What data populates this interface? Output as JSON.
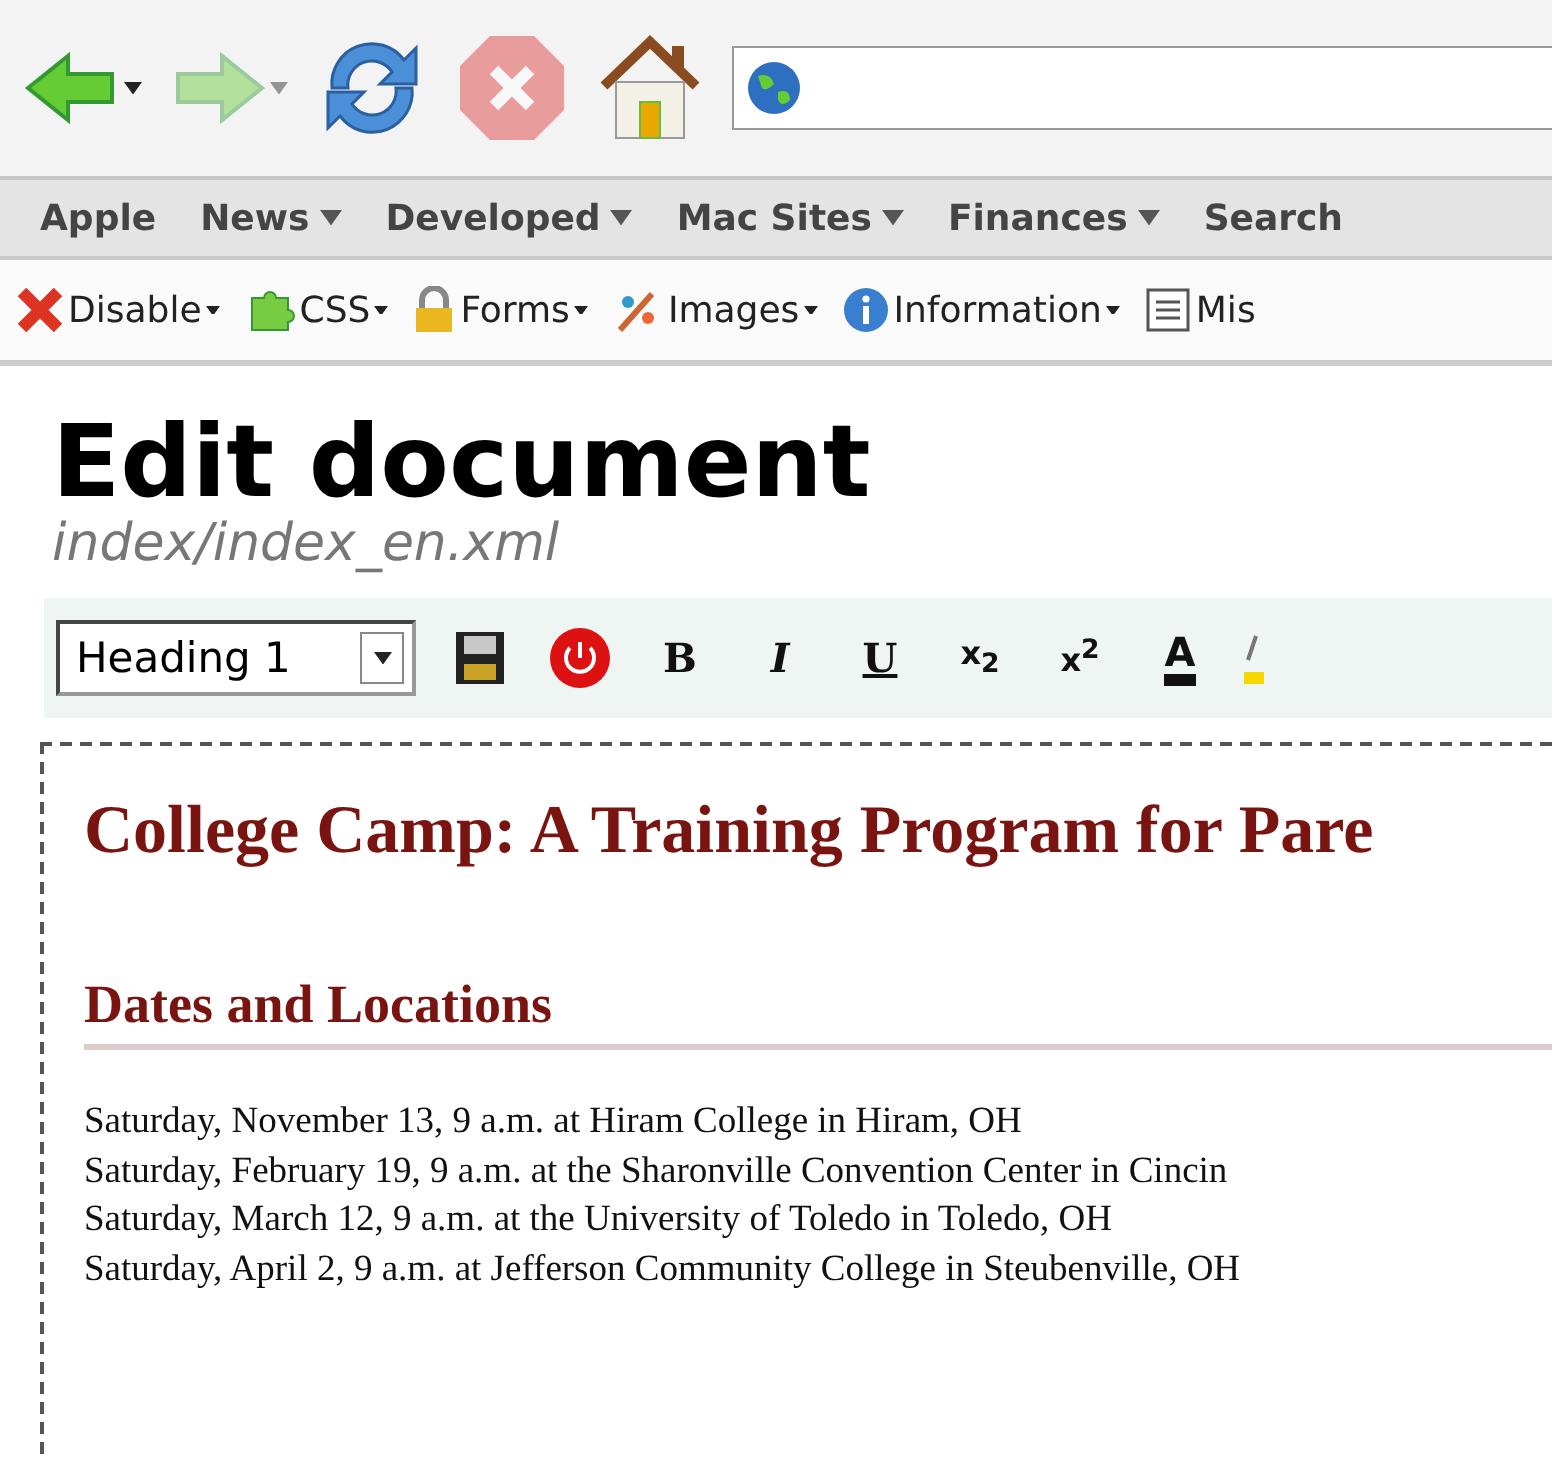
{
  "nav_toolbar": {
    "buttons": [
      {
        "kind": "back",
        "disabled": false,
        "menu": true
      },
      {
        "kind": "forward",
        "disabled": true,
        "menu": true
      },
      {
        "kind": "reload",
        "disabled": false,
        "menu": false
      },
      {
        "kind": "stop",
        "disabled": true,
        "menu": false
      },
      {
        "kind": "home",
        "disabled": false,
        "menu": false
      }
    ]
  },
  "bookmarks": [
    {
      "label": "Apple",
      "dropdown": false
    },
    {
      "label": "News",
      "dropdown": true
    },
    {
      "label": "Developed",
      "dropdown": true
    },
    {
      "label": "Mac Sites",
      "dropdown": true
    },
    {
      "label": "Finances",
      "dropdown": true
    },
    {
      "label": "Search",
      "dropdown": false
    }
  ],
  "dev_toolbar": [
    {
      "kind": "disable",
      "label": "Disable"
    },
    {
      "kind": "css",
      "label": "CSS"
    },
    {
      "kind": "forms",
      "label": "Forms"
    },
    {
      "kind": "images",
      "label": "Images"
    },
    {
      "kind": "information",
      "label": "Information"
    },
    {
      "kind": "misc",
      "label": "Mis"
    }
  ],
  "page": {
    "title": "Edit document",
    "path": "index/index_en.xml"
  },
  "editor_toolbar": {
    "format_select": {
      "value": "Heading 1"
    },
    "buttons": [
      {
        "kind": "save"
      },
      {
        "kind": "close"
      },
      {
        "kind": "bold",
        "text": "B"
      },
      {
        "kind": "italic",
        "text": "I"
      },
      {
        "kind": "underline",
        "text": "U"
      },
      {
        "kind": "subscript",
        "text": "x$_{2}$"
      },
      {
        "kind": "superscript",
        "text": "x$^{2}$"
      },
      {
        "kind": "font-color",
        "text": "A"
      },
      {
        "kind": "highlight"
      }
    ]
  },
  "document": {
    "heading": "College Camp: A Training Program for Pare",
    "section_heading": "Dates and Locations",
    "lines": [
      "Saturday, November 13, 9 a.m. at Hiram College in Hiram, OH",
      "Saturday, February 19, 9 a.m. at the Sharonville Convention Center in Cincin",
      "Saturday, March 12, 9 a.m. at the University of Toledo in Toledo, OH",
      "Saturday, April 2, 9 a.m. at Jefferson Community College in Steubenville, OH"
    ]
  }
}
